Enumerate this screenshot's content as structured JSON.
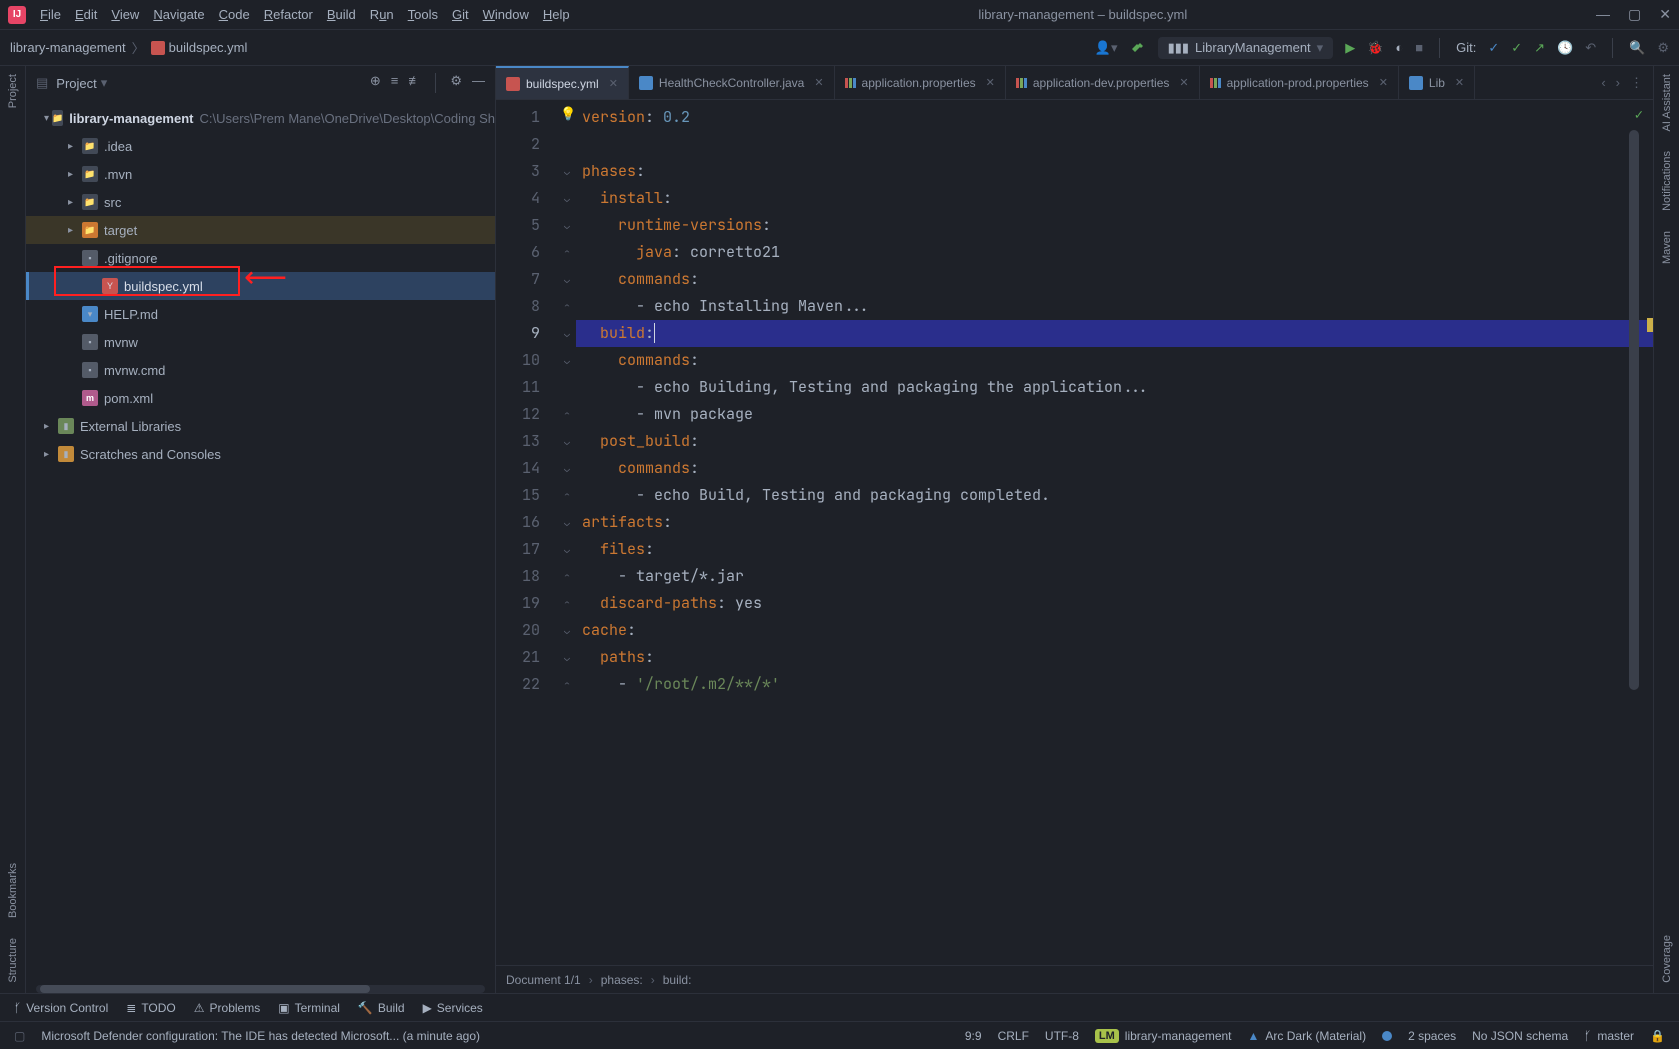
{
  "window": {
    "title": "library-management – buildspec.yml",
    "menus": [
      "File",
      "Edit",
      "View",
      "Navigate",
      "Code",
      "Refactor",
      "Build",
      "Run",
      "Tools",
      "Git",
      "Window",
      "Help"
    ]
  },
  "breadcrumb": {
    "project": "library-management",
    "file": "buildspec.yml"
  },
  "runConfig": "LibraryManagement",
  "gitLabel": "Git:",
  "leftRail": {
    "project": "Project",
    "bookmarks": "Bookmarks",
    "structure": "Structure"
  },
  "rightRail": {
    "ai": "AI Assistant",
    "notifications": "Notifications",
    "maven": "Maven",
    "coverage": "Coverage"
  },
  "panel": {
    "title": "Project",
    "rootName": "library-management",
    "rootPath": "C:\\Users\\Prem Mane\\OneDrive\\Desktop\\Coding Sh",
    "tree": [
      {
        "name": ".idea",
        "type": "folder",
        "depth": 1,
        "expand": true
      },
      {
        "name": ".mvn",
        "type": "folder",
        "depth": 1,
        "expand": true
      },
      {
        "name": "src",
        "type": "folder",
        "depth": 1,
        "expand": true
      },
      {
        "name": "target",
        "type": "folder-orange",
        "depth": 1,
        "expand": true,
        "hl": "target"
      },
      {
        "name": ".gitignore",
        "type": "file",
        "depth": 1
      },
      {
        "name": "buildspec.yml",
        "type": "yml",
        "depth": 1,
        "selected": true,
        "boxed": true
      },
      {
        "name": "HELP.md",
        "type": "md",
        "depth": 1
      },
      {
        "name": "mvnw",
        "type": "file",
        "depth": 1
      },
      {
        "name": "mvnw.cmd",
        "type": "file",
        "depth": 1
      },
      {
        "name": "pom.xml",
        "type": "m",
        "depth": 1
      }
    ],
    "extLibs": "External Libraries",
    "scratches": "Scratches and Consoles"
  },
  "tabs": [
    {
      "label": "buildspec.yml",
      "icon": "yml",
      "active": true
    },
    {
      "label": "HealthCheckController.java",
      "icon": "java"
    },
    {
      "label": "application.properties",
      "icon": "prop"
    },
    {
      "label": "application-dev.properties",
      "icon": "prop"
    },
    {
      "label": "application-prod.properties",
      "icon": "prop"
    },
    {
      "label": "Lib",
      "icon": "g",
      "trunc": true
    }
  ],
  "code": {
    "lines": [
      {
        "n": 1,
        "seg": [
          [
            "kw",
            "version"
          ],
          [
            "val",
            ": "
          ],
          [
            "num",
            "0.2"
          ]
        ]
      },
      {
        "n": 2,
        "seg": []
      },
      {
        "n": 3,
        "seg": [
          [
            "kw",
            "phases"
          ],
          [
            "val",
            ":"
          ]
        ],
        "fold": "down"
      },
      {
        "n": 4,
        "seg": [
          [
            "val",
            "  "
          ],
          [
            "kw",
            "install"
          ],
          [
            "val",
            ":"
          ]
        ],
        "fold": "down"
      },
      {
        "n": 5,
        "seg": [
          [
            "val",
            "    "
          ],
          [
            "kw",
            "runtime-versions"
          ],
          [
            "val",
            ":"
          ]
        ],
        "fold": "down"
      },
      {
        "n": 6,
        "seg": [
          [
            "val",
            "      "
          ],
          [
            "kw",
            "java"
          ],
          [
            "val",
            ": corretto21"
          ]
        ],
        "fold": "up"
      },
      {
        "n": 7,
        "seg": [
          [
            "val",
            "    "
          ],
          [
            "kw",
            "commands"
          ],
          [
            "val",
            ":"
          ]
        ],
        "fold": "down"
      },
      {
        "n": 8,
        "seg": [
          [
            "val",
            "      - echo Installing Maven..."
          ]
        ],
        "fold": "up",
        "bulb": true
      },
      {
        "n": 9,
        "seg": [
          [
            "val",
            "  "
          ],
          [
            "kw",
            "build"
          ],
          [
            "val",
            ":"
          ]
        ],
        "fold": "down",
        "current": true
      },
      {
        "n": 10,
        "seg": [
          [
            "val",
            "    "
          ],
          [
            "kw",
            "commands"
          ],
          [
            "val",
            ":"
          ]
        ],
        "fold": "down"
      },
      {
        "n": 11,
        "seg": [
          [
            "val",
            "      - echo Building, Testing and packaging the application..."
          ]
        ]
      },
      {
        "n": 12,
        "seg": [
          [
            "val",
            "      - mvn package"
          ]
        ],
        "fold": "up"
      },
      {
        "n": 13,
        "seg": [
          [
            "val",
            "  "
          ],
          [
            "kw",
            "post_build"
          ],
          [
            "val",
            ":"
          ]
        ],
        "fold": "down"
      },
      {
        "n": 14,
        "seg": [
          [
            "val",
            "    "
          ],
          [
            "kw",
            "commands"
          ],
          [
            "val",
            ":"
          ]
        ],
        "fold": "down"
      },
      {
        "n": 15,
        "seg": [
          [
            "val",
            "      - echo Build, Testing and packaging completed."
          ]
        ],
        "fold": "up"
      },
      {
        "n": 16,
        "seg": [
          [
            "kw",
            "artifacts"
          ],
          [
            "val",
            ":"
          ]
        ],
        "fold": "down"
      },
      {
        "n": 17,
        "seg": [
          [
            "val",
            "  "
          ],
          [
            "kw",
            "files"
          ],
          [
            "val",
            ":"
          ]
        ],
        "fold": "down"
      },
      {
        "n": 18,
        "seg": [
          [
            "val",
            "    - target/*.jar"
          ]
        ],
        "fold": "up"
      },
      {
        "n": 19,
        "seg": [
          [
            "val",
            "  "
          ],
          [
            "kw",
            "discard-paths"
          ],
          [
            "val",
            ": yes"
          ]
        ],
        "fold": "up"
      },
      {
        "n": 20,
        "seg": [
          [
            "kw",
            "cache"
          ],
          [
            "val",
            ":"
          ]
        ],
        "fold": "down"
      },
      {
        "n": 21,
        "seg": [
          [
            "val",
            "  "
          ],
          [
            "kw",
            "paths"
          ],
          [
            "val",
            ":"
          ]
        ],
        "fold": "down"
      },
      {
        "n": 22,
        "seg": [
          [
            "val",
            "    - "
          ],
          [
            "str",
            "'/root/.m2/**/*'"
          ]
        ],
        "fold": "up"
      }
    ]
  },
  "editorCrumb": {
    "doc": "Document 1/1",
    "p1": "phases:",
    "p2": "build:"
  },
  "toolWindows": [
    {
      "label": "Version Control",
      "icon": "branch"
    },
    {
      "label": "TODO",
      "icon": "list"
    },
    {
      "label": "Problems",
      "icon": "warn"
    },
    {
      "label": "Terminal",
      "icon": "term"
    },
    {
      "label": "Build",
      "icon": "hammer"
    },
    {
      "label": "Services",
      "icon": "play"
    }
  ],
  "status": {
    "msg": "Microsoft Defender configuration: The IDE has detected Microsoft... (a minute ago)",
    "pos": "9:9",
    "eol": "CRLF",
    "enc": "UTF-8",
    "proj": "library-management",
    "theme": "Arc Dark (Material)",
    "indent": "2 spaces",
    "schema": "No JSON schema",
    "branch": "master"
  }
}
